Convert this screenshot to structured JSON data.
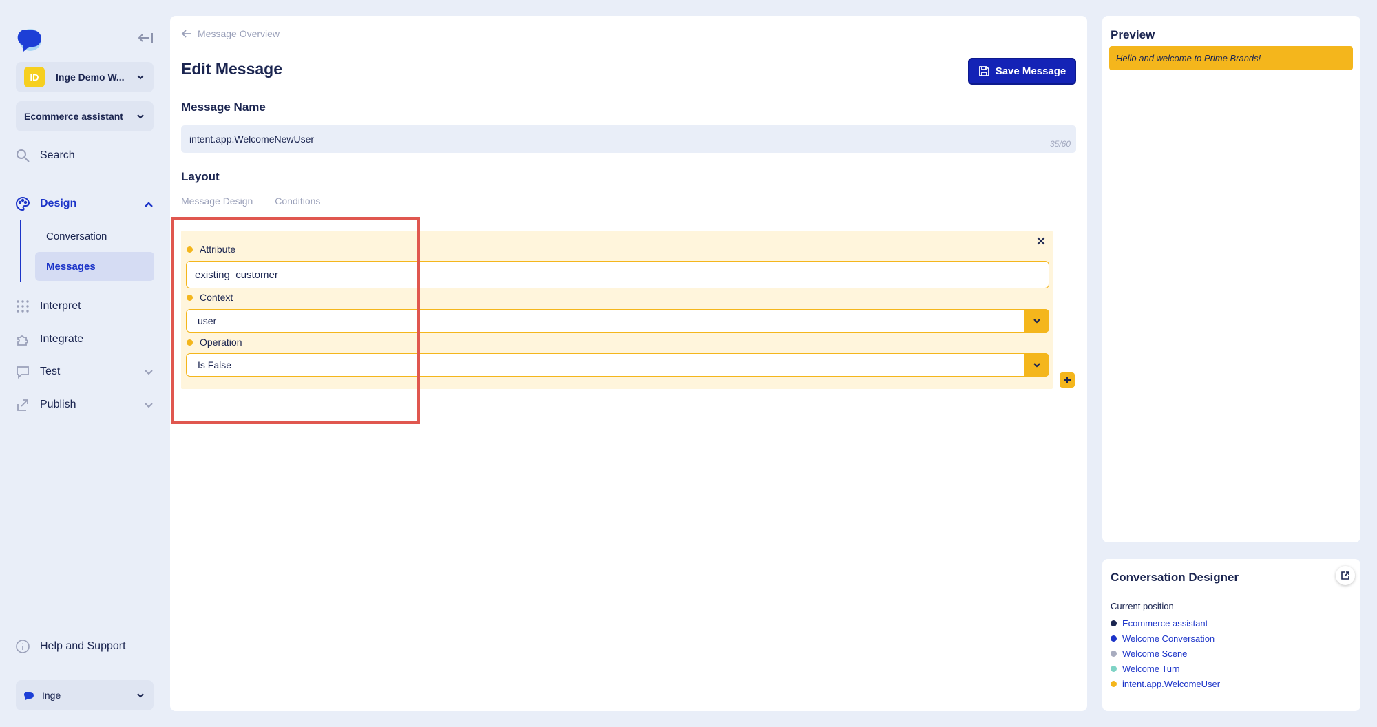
{
  "sidebar": {
    "workspace": {
      "badge": "ID",
      "label": "Inge Demo W..."
    },
    "assistant": {
      "label": "Ecommerce assistant"
    },
    "nav": {
      "search": "Search",
      "design": "Design",
      "conversation": "Conversation",
      "messages": "Messages",
      "interpret": "Interpret",
      "integrate": "Integrate",
      "test": "Test",
      "publish": "Publish",
      "help": "Help and Support"
    },
    "user": {
      "label": "Inge"
    }
  },
  "main": {
    "breadcrumb": "Message Overview",
    "title": "Edit Message",
    "save_label": "Save Message",
    "message_name_label": "Message Name",
    "message_name_value": "intent.app.WelcomeNewUser",
    "char_count": "35/60",
    "layout_label": "Layout",
    "tabs": [
      "Message Design",
      "Conditions"
    ],
    "condition": {
      "attribute_label": "Attribute",
      "attribute_value": "existing_customer",
      "context_label": "Context",
      "context_value": "user",
      "operation_label": "Operation",
      "operation_value": "Is False"
    }
  },
  "preview": {
    "title": "Preview",
    "bubble": "Hello and welcome to Prime Brands!"
  },
  "designer": {
    "title": "Conversation Designer",
    "position_label": "Current position",
    "items": [
      {
        "label": "Ecommerce assistant",
        "color": "#1b2550"
      },
      {
        "label": "Welcome Conversation",
        "color": "#1c34c8"
      },
      {
        "label": "Welcome Scene",
        "color": "#a8acbf"
      },
      {
        "label": "Welcome Turn",
        "color": "#7fd3c5"
      },
      {
        "label": "intent.app.WelcomeUser",
        "color": "#f4b61c"
      }
    ]
  },
  "colors": {
    "accent": "#1c34c8",
    "save_button": "#1423b6",
    "condition_accent": "#f4b61c",
    "highlight": "#e0574f",
    "background": "#e9eef8"
  }
}
